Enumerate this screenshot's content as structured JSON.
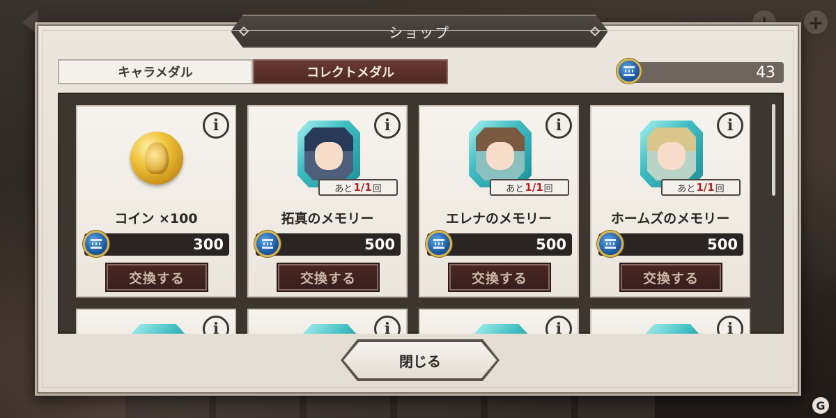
{
  "background": {
    "plus_symbol": "+",
    "watermark": "G"
  },
  "modal": {
    "title": "ショップ",
    "tabs": [
      {
        "label": "キャラメダル",
        "active": false
      },
      {
        "label": "コレクトメダル",
        "active": true
      }
    ],
    "balance": "43",
    "info_symbol": "i",
    "items": [
      {
        "name": "コイン ×100",
        "price": "300",
        "button": "交換する",
        "icon": "gold-coin-icon"
      },
      {
        "name": "拓真のメモリー",
        "price": "500",
        "button": "交換する",
        "limit_prefix": "あと",
        "limit_value": "1/1",
        "limit_suffix": "回"
      },
      {
        "name": "エレナのメモリー",
        "price": "500",
        "button": "交換する",
        "limit_prefix": "あと",
        "limit_value": "1/1",
        "limit_suffix": "回"
      },
      {
        "name": "ホームズのメモリー",
        "price": "500",
        "button": "交換する",
        "limit_prefix": "あと",
        "limit_value": "1/1",
        "limit_suffix": "回"
      }
    ],
    "close_label": "閉じる"
  },
  "colors": {
    "accent_tab": "#5a2f29",
    "limit_red": "#b11f1f",
    "medal_blue": "#1d5aa2",
    "medal_rim": "#d9b552"
  }
}
